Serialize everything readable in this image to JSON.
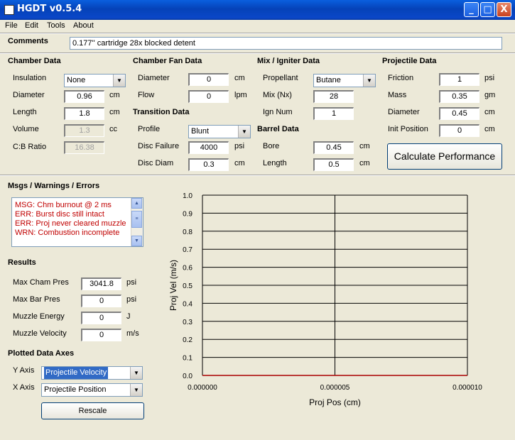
{
  "window": {
    "title": "HGDT v0.5.4",
    "minimize": "_",
    "maximize": "□",
    "close": "X"
  },
  "menu": [
    "File",
    "Edit",
    "Tools",
    "About"
  ],
  "comments": {
    "label": "Comments",
    "value": "0.177'' cartridge 28x blocked detent"
  },
  "chamber": {
    "header": "Chamber Data",
    "insulation": {
      "label": "Insulation",
      "value": "None"
    },
    "diameter": {
      "label": "Diameter",
      "value": "0.96",
      "unit": "cm"
    },
    "length": {
      "label": "Length",
      "value": "1.8",
      "unit": "cm"
    },
    "volume": {
      "label": "Volume",
      "value": "1.3",
      "unit": "cc"
    },
    "cb_ratio": {
      "label": "C:B Ratio",
      "value": "16.38"
    }
  },
  "chamber_fan": {
    "header": "Chamber Fan Data",
    "diameter": {
      "label": "Diameter",
      "value": "0",
      "unit": "cm"
    },
    "flow": {
      "label": "Flow",
      "value": "0",
      "unit": "lpm"
    }
  },
  "transition": {
    "header": "Transition Data",
    "profile": {
      "label": "Profile",
      "value": "Blunt"
    },
    "disc_failure": {
      "label": "Disc Failure",
      "value": "4000",
      "unit": "psi"
    },
    "disc_diam": {
      "label": "Disc Diam",
      "value": "0.3",
      "unit": "cm"
    }
  },
  "mix": {
    "header": "Mix / Igniter Data",
    "propellant": {
      "label": "Propellant",
      "value": "Butane"
    },
    "mix_nx": {
      "label": "Mix (Nx)",
      "value": "28"
    },
    "ign_num": {
      "label": "Ign Num",
      "value": "1"
    }
  },
  "barrel": {
    "header": "Barrel Data",
    "bore": {
      "label": "Bore",
      "value": "0.45",
      "unit": "cm"
    },
    "length": {
      "label": "Length",
      "value": "0.5",
      "unit": "cm"
    }
  },
  "projectile": {
    "header": "Projectile Data",
    "friction": {
      "label": "Friction",
      "value": "1",
      "unit": "psi"
    },
    "mass": {
      "label": "Mass",
      "value": "0.35",
      "unit": "gm"
    },
    "diameter": {
      "label": "Diameter",
      "value": "0.45",
      "unit": "cm"
    },
    "init_position": {
      "label": "Init Position",
      "value": "0",
      "unit": "cm"
    }
  },
  "calculate_button": "Calculate Performance",
  "messages": {
    "header": "Msgs / Warnings / Errors",
    "items": [
      "MSG: Chm burnout @ 2 ms",
      "ERR: Burst disc still intact",
      "ERR: Proj never cleared muzzle",
      "WRN: Combustion incomplete"
    ]
  },
  "results": {
    "header": "Results",
    "max_cham_pres": {
      "label": "Max Cham Pres",
      "value": "3041.8",
      "unit": "psi"
    },
    "max_bar_pres": {
      "label": "Max Bar Pres",
      "value": "0",
      "unit": "psi"
    },
    "muzzle_energy": {
      "label": "Muzzle Energy",
      "value": "0",
      "unit": "J"
    },
    "muzzle_velocity": {
      "label": "Muzzle Velocity",
      "value": "0",
      "unit": "m/s"
    }
  },
  "axes": {
    "header": "Plotted Data Axes",
    "y_axis": {
      "label": "Y Axis",
      "value": "Projectile Velocity"
    },
    "x_axis": {
      "label": "X Axis",
      "value": "Projectile Position"
    },
    "rescale": "Rescale"
  },
  "chart_data": {
    "type": "line",
    "xlabel": "Proj Pos (cm)",
    "ylabel": "Proj Vel (m/s)",
    "xlim": [
      0,
      1e-05
    ],
    "ylim": [
      0,
      1.0
    ],
    "x_ticks": [
      "0.000000",
      "0.000005",
      "0.000010"
    ],
    "y_ticks": [
      "0.0",
      "0.1",
      "0.2",
      "0.3",
      "0.4",
      "0.5",
      "0.6",
      "0.7",
      "0.8",
      "0.9",
      "1.0"
    ],
    "grid": true,
    "series": [
      {
        "x": [
          0,
          1e-05
        ],
        "y": [
          0,
          0
        ],
        "color": "#aa0000"
      }
    ]
  }
}
